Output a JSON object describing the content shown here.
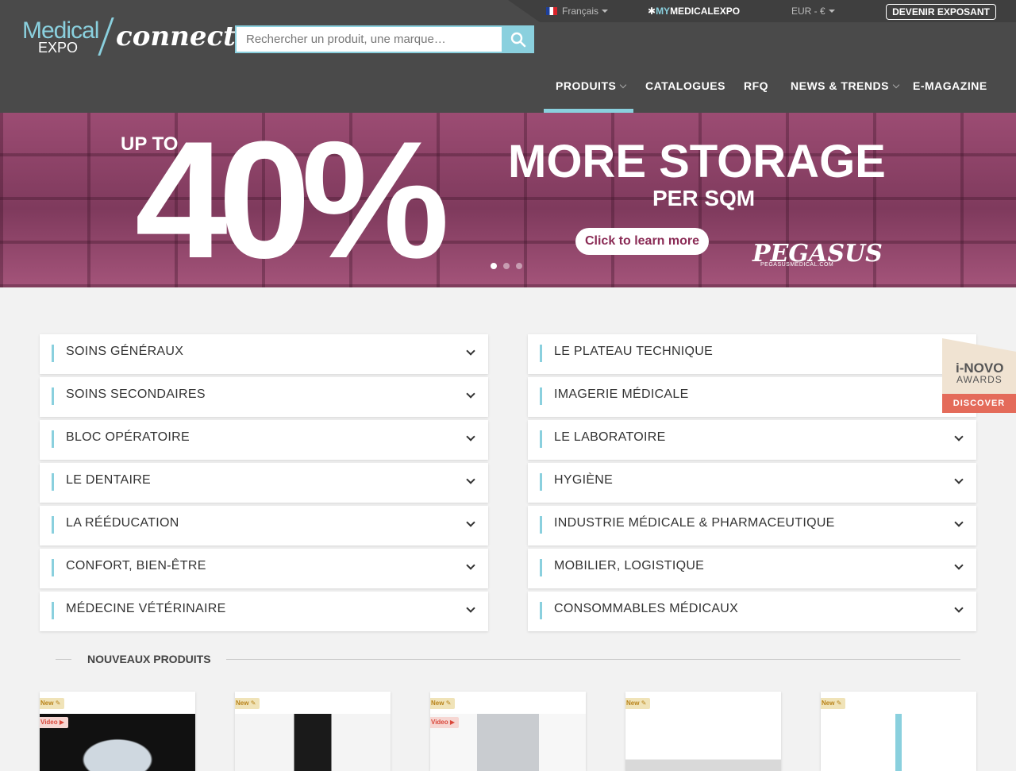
{
  "brand": {
    "medical": "Medical",
    "expo": "EXPO",
    "connect": "connect"
  },
  "search": {
    "placeholder": "Rechercher un produit, une marque…"
  },
  "topbar": {
    "language": "Français",
    "my": "MY",
    "mymx": "MEDICALEXPO",
    "currency": "EUR - €",
    "exposant": "DEVENIR EXPOSANT"
  },
  "nav": [
    {
      "label": "PRODUITS"
    },
    {
      "label": "CATALOGUES"
    },
    {
      "label": "RFQ"
    },
    {
      "label": "NEWS & TRENDS"
    },
    {
      "label": "E-MAGAZINE"
    }
  ],
  "banner": {
    "upto": "UP TO",
    "percent": "40%",
    "more": "MORE STORAGE",
    "persqm": "PER SQM",
    "cta": "Click to learn more",
    "brand": "PEGASUS",
    "brand_url": "PEGASUSMEDICAL.COM"
  },
  "categories_left": [
    "SOINS GÉNÉRAUX",
    "SOINS SECONDAIRES",
    "BLOC OPÉRATOIRE",
    "LE DENTAIRE",
    "LA RÉÉDUCATION",
    "CONFORT, BIEN-ÊTRE",
    "MÉDECINE VÉTÉRINAIRE"
  ],
  "categories_right": [
    "LE PLATEAU TECHNIQUE",
    "IMAGERIE MÉDICALE",
    "LE LABORATOIRE",
    "HYGIÈNE",
    "INDUSTRIE MÉDICALE & PHARMACEUTIQUE",
    "MOBILIER, LOGISTIQUE",
    "CONSOMMABLES MÉDICAUX"
  ],
  "section": {
    "new_products": "NOUVEAUX PRODUITS"
  },
  "badges": {
    "new": "New",
    "video": "Video"
  },
  "products": [
    {
      "new": true,
      "video": true
    },
    {
      "new": true,
      "video": false
    },
    {
      "new": true,
      "video": true
    },
    {
      "new": true,
      "video": false
    },
    {
      "new": true,
      "video": false
    }
  ],
  "inovo": {
    "title": "i-NOVO",
    "sub": "AWARDS",
    "cta": "DISCOVER"
  },
  "colors": {
    "accent": "#8ad0de",
    "header": "#4a4a4a",
    "banner": "#8a4566"
  }
}
